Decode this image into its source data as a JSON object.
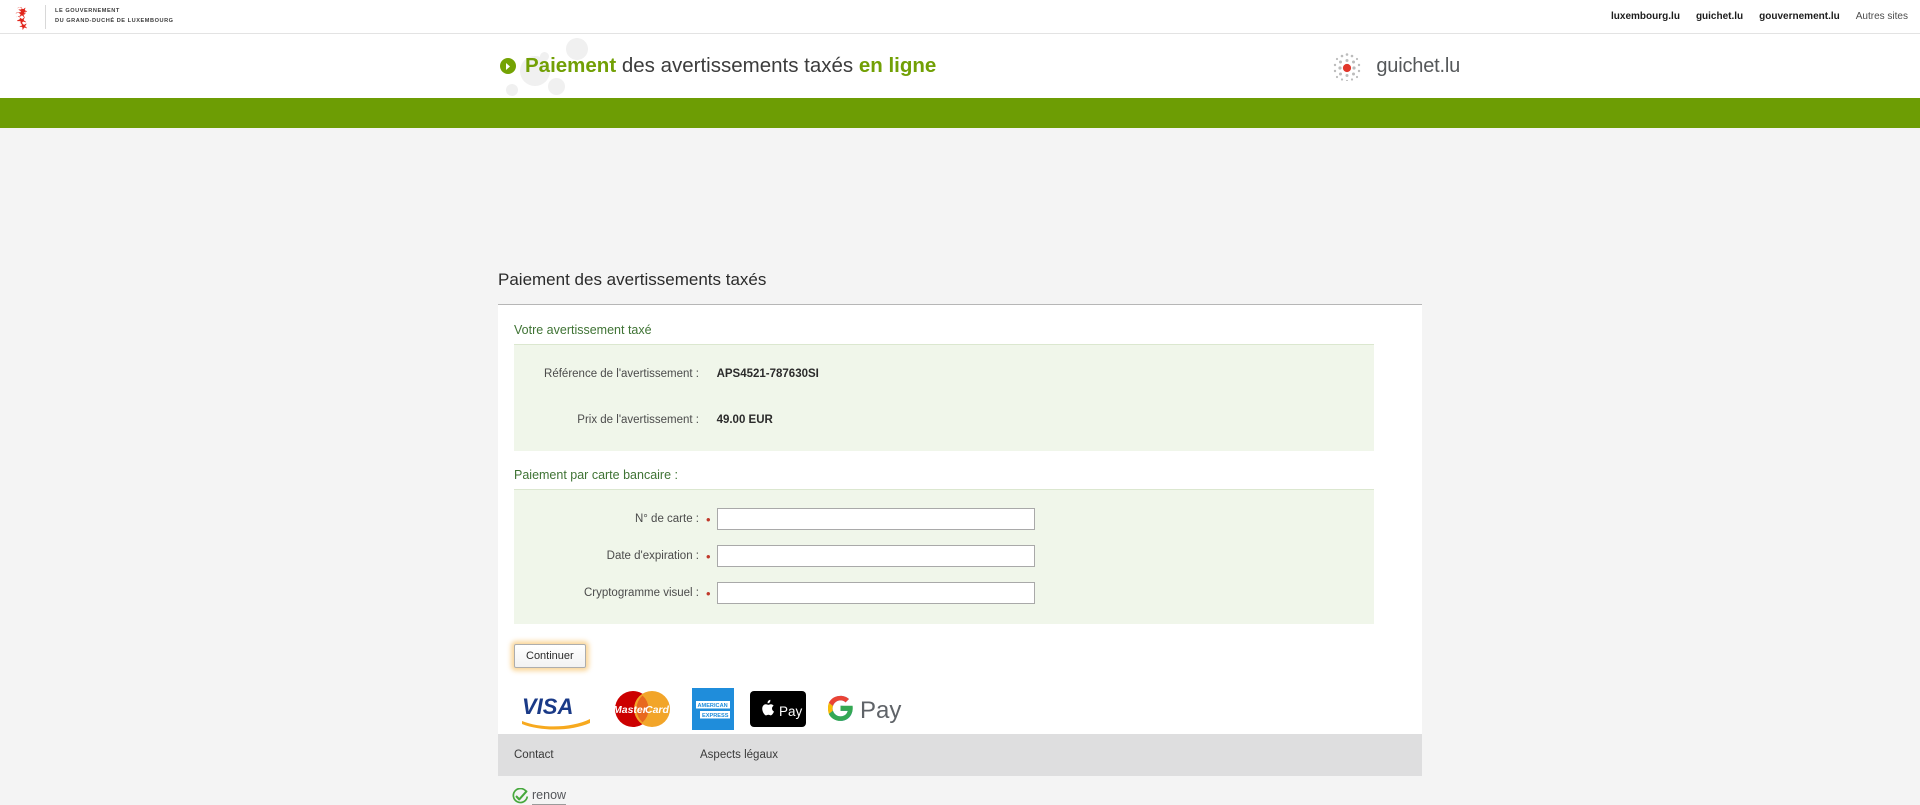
{
  "topbar": {
    "government_line1": "LE GOUVERNEMENT",
    "government_line2": "DU GRAND-DUCHÉ DE LUXEMBOURG",
    "crest_icon": "luxembourg-lion-crest-icon",
    "links": [
      {
        "label": "luxembourg.lu",
        "strong": true
      },
      {
        "label": "guichet.lu",
        "strong": true
      },
      {
        "label": "gouvernement.lu",
        "strong": true
      },
      {
        "label": "Autres sites",
        "strong": false
      }
    ]
  },
  "banner": {
    "arrow_icon": "chevron-right-circle-icon",
    "title_part1": "Paiement",
    "title_part2": " des avertissements taxés ",
    "title_part3": "en ligne",
    "brand_icon": "guichet-dots-icon",
    "brand_name": "guichet.lu",
    "accent_green": "#72a005",
    "bar_green": "#6d9d04"
  },
  "page": {
    "title": "Paiement des avertissements taxés"
  },
  "notice_section": {
    "heading": "Votre avertissement taxé",
    "rows": [
      {
        "label": "Référence de l'avertissement :",
        "value": "APS4521-787630SI"
      },
      {
        "label": "Prix de l'avertissement :",
        "value": "49.00 EUR"
      }
    ]
  },
  "payment_section": {
    "heading": "Paiement par carte bancaire :",
    "required_marker": "•",
    "fields": [
      {
        "label": "N° de carte :",
        "value": "",
        "placeholder": ""
      },
      {
        "label": "Date d'expiration :",
        "value": "",
        "placeholder": ""
      },
      {
        "label": "Cryptogramme visuel :",
        "value": "",
        "placeholder": ""
      }
    ],
    "submit_label": "Continuer"
  },
  "payment_logos": [
    {
      "name": "visa-logo",
      "label": "VISA"
    },
    {
      "name": "mastercard-logo",
      "label": "MasterCard"
    },
    {
      "name": "american-express-logo",
      "label": "AMERICAN EXPRESS"
    },
    {
      "name": "apple-pay-logo",
      "label": "Pay"
    },
    {
      "name": "google-pay-logo",
      "label": "Pay"
    }
  ],
  "footer": {
    "contact": "Contact",
    "legal": "Aspects légaux",
    "renow_label": "renow",
    "renow_icon": "renow-check-icon"
  }
}
